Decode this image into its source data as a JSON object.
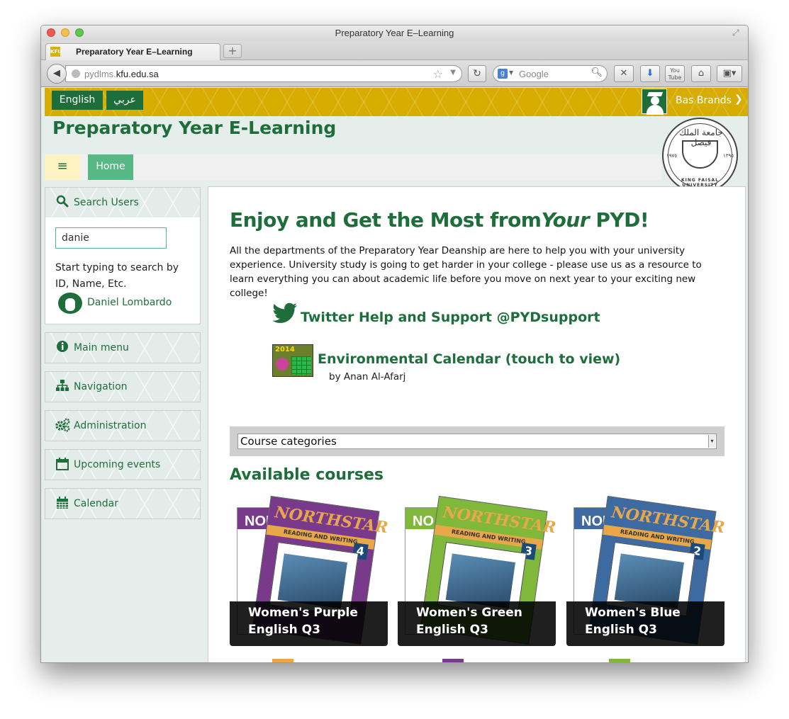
{
  "browser": {
    "window_title": "Preparatory Year E–Learning",
    "tab_label": "Preparatory Year E–Learning",
    "tab_favicon": "KFU",
    "url_prefix": "pydlms.",
    "url_domain": "kfu.edu.sa",
    "search_placeholder": "Google",
    "search_engine_letter": "g",
    "youtube_label": "You Tube"
  },
  "header": {
    "lang_english": "English",
    "lang_arabic": "عربي",
    "user_name": "Bas Brands",
    "site_title": "Preparatory Year E-Learning",
    "home_label": "Home"
  },
  "logo": {
    "script": "جامعة الملك فيصل",
    "year_left": "١٩٧٥",
    "year_right": "١٣٩٥",
    "university_name": "KING FAISAL UNIVERSITY"
  },
  "sidebar": {
    "search_users": {
      "title": "Search Users",
      "input_value": "danie",
      "hint": "Start typing to search by ID, Name, Etc.",
      "result_name": "Daniel Lombardo"
    },
    "blocks": [
      {
        "label": "Main menu",
        "icon": "info-circle-icon"
      },
      {
        "label": "Navigation",
        "icon": "sitemap-icon"
      },
      {
        "label": "Administration",
        "icon": "gears-icon"
      },
      {
        "label": "Upcoming events",
        "icon": "calendar-empty-icon"
      },
      {
        "label": "Calendar",
        "icon": "calendar-grid-icon"
      }
    ]
  },
  "main": {
    "hero_prefix": "Enjoy and Get the Most from",
    "hero_your": "Your",
    "hero_suffix": " PYD!",
    "intro": "All the departments of the Preparatory Year Deanship are here to help you with your university experience. University study is going to get harder in your college - please use us as a resource to learn everything you can about academic life before you move on next year to your exciting new college!",
    "twitter_link": "Twitter Help and Support @PYDsupport",
    "calendar_year": "2014",
    "calendar_link": "Environmental Calendar (touch to view)",
    "calendar_by": "by Anan Al-Afarj",
    "course_categories": "Course categories",
    "available_courses": "Available courses",
    "courses": [
      {
        "title": "Women's Purple English Q3",
        "book": "NORTHSTAR",
        "level": "4",
        "back": "NOR"
      },
      {
        "title": "Women's Green English Q3",
        "book": "NORTHSTAR",
        "level": "3",
        "back": "NO"
      },
      {
        "title": "Women's Blue English Q3",
        "book": "NORTHSTAR",
        "level": "2",
        "back": "NOR"
      }
    ],
    "book_subtitle": "READING AND WRITING"
  },
  "colors": {
    "brand_green": "#1e6e3c",
    "accent_gold": "#d6ad00",
    "home_green": "#57b886",
    "purple": "#7a3a8c",
    "green": "#7fb83a",
    "blue": "#3d6aa0"
  }
}
